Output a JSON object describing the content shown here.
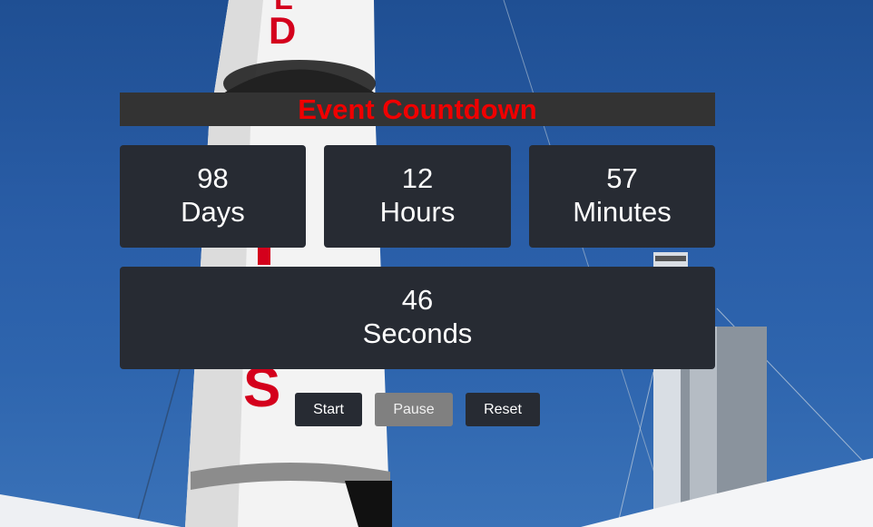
{
  "title": "Event Countdown",
  "countdown": {
    "days": {
      "value": "98",
      "label": "Days"
    },
    "hours": {
      "value": "12",
      "label": "Hours"
    },
    "minutes": {
      "value": "57",
      "label": "Minutes"
    },
    "seconds": {
      "value": "46",
      "label": "Seconds"
    }
  },
  "controls": {
    "start_label": "Start",
    "pause_label": "Pause",
    "reset_label": "Reset"
  },
  "colors": {
    "title_text": "#f00000",
    "title_bar": "#333333",
    "box_bg": "#272b33",
    "button_active": "#272b33",
    "button_disabled": "#808080"
  }
}
